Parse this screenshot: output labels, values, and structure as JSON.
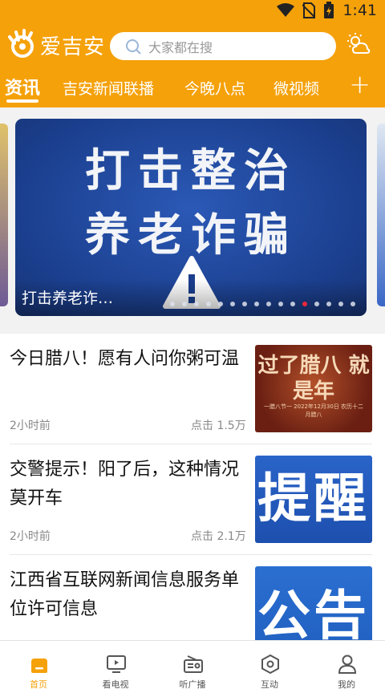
{
  "status": {
    "time": "1:41"
  },
  "app": {
    "name": "爱吉安"
  },
  "search": {
    "placeholder": "大家都在搜"
  },
  "tabs": [
    {
      "label": "资讯",
      "active": true
    },
    {
      "label": "吉安新闻联播"
    },
    {
      "label": "今晚八点"
    },
    {
      "label": "微视频"
    }
  ],
  "banner": {
    "line1": "打击整治",
    "line2": "养老诈骗",
    "caption": "打击养老诈…",
    "dot_count": 16,
    "active_dot": 11
  },
  "news": [
    {
      "title": "今日腊八！愿有人问你粥可温",
      "time": "2小时前",
      "clicks": "点击 1.5万",
      "thumb": {
        "big": "过了腊八 就是年",
        "small": "一腊八节一 2022年12月30日 农历十二月腊八"
      }
    },
    {
      "title": "交警提示！阳了后，这种情况莫开车",
      "time": "2小时前",
      "clicks": "点击 2.1万",
      "thumb": {
        "big": "提醒"
      }
    },
    {
      "title": "江西省互联网新闻信息服务单位许可信息",
      "time": "",
      "clicks": "",
      "thumb": {
        "big": "公告"
      }
    }
  ],
  "nav": [
    {
      "label": "首页",
      "icon": "home-icon",
      "active": true
    },
    {
      "label": "看电视",
      "icon": "tv-icon"
    },
    {
      "label": "听广播",
      "icon": "radio-icon"
    },
    {
      "label": "互动",
      "icon": "interact-icon"
    },
    {
      "label": "我的",
      "icon": "user-icon"
    }
  ],
  "colors": {
    "brand": "#f5a10a",
    "accent_dot": "#e8283a"
  }
}
